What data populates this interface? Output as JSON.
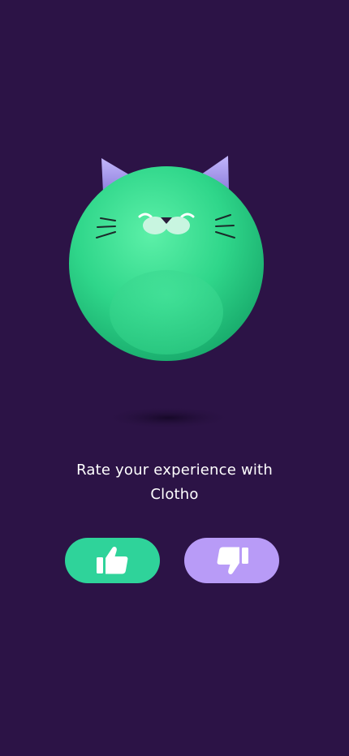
{
  "prompt": {
    "line1": "Rate your experience with",
    "line2": "Clotho"
  },
  "buttons": {
    "like_icon": "thumbs-up-icon",
    "dislike_icon": "thumbs-down-icon"
  },
  "colors": {
    "background": "#2c1346",
    "like_button": "#2fd39a",
    "dislike_button": "#b89bf7",
    "mascot_body": "#33d98c",
    "mascot_ears": "#a99be8",
    "text": "#ffffff"
  }
}
